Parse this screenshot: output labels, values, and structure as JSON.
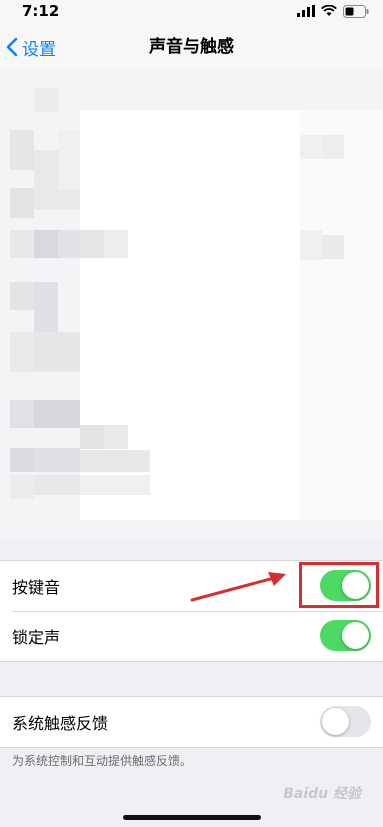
{
  "status_bar": {
    "time": "7:12",
    "icons": [
      "signal-icon",
      "wifi-icon",
      "battery-icon"
    ]
  },
  "nav": {
    "back_label": "设置",
    "title": "声音与触感"
  },
  "sound_group": {
    "rows": [
      {
        "label": "按键音",
        "toggle_on": true
      },
      {
        "label": "锁定声",
        "toggle_on": true
      }
    ]
  },
  "haptics_group": {
    "rows": [
      {
        "label": "系统触感反馈",
        "toggle_on": false
      }
    ],
    "footnote": "为系统控制和互动提供触感反馈。"
  },
  "annotation": {
    "color": "#d62f2f"
  },
  "colors": {
    "accent": "#0a84ff",
    "switch_on": "#4cd964",
    "switch_off": "#e5e5ea"
  },
  "watermark": "Baidu 经验"
}
